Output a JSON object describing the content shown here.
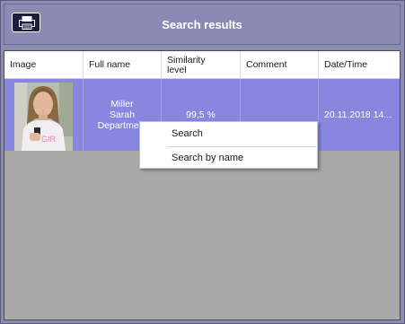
{
  "header": {
    "title": "Search results",
    "print_icon": "printer-icon"
  },
  "table": {
    "columns": [
      {
        "label": "Image"
      },
      {
        "label": "Full name"
      },
      {
        "label": "Similarity level"
      },
      {
        "label": "Comment"
      },
      {
        "label": "Date/Time"
      }
    ],
    "rows": [
      {
        "image": "person-photo",
        "name_line1": "Miller",
        "name_line2": "Sarah",
        "name_line3": "Department",
        "similarity": "99,5 %",
        "comment": "",
        "datetime": "20.11.2018 14..."
      }
    ]
  },
  "context_menu": {
    "items": [
      {
        "label": "Search"
      },
      {
        "label": "Search by name"
      }
    ]
  },
  "colors": {
    "background": "#8b8bb4",
    "selected_row": "#8787df",
    "panel_empty": "#a9a9a9"
  }
}
